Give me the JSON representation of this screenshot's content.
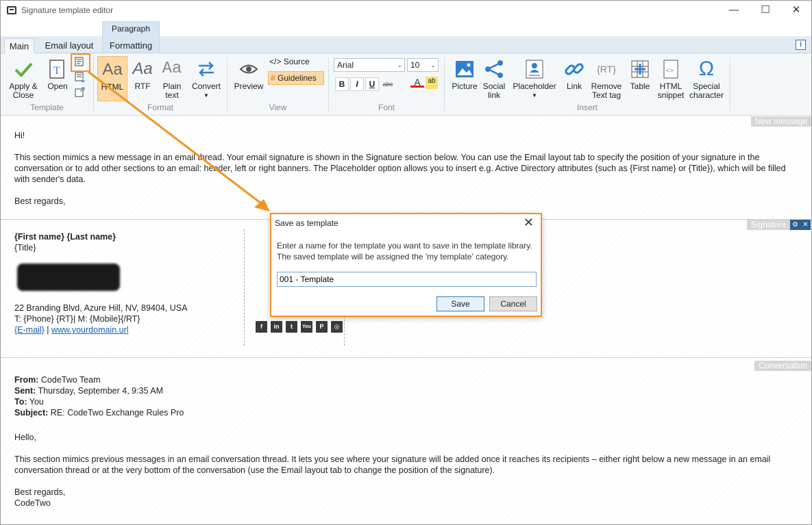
{
  "window": {
    "title": "Signature template editor",
    "minimize": "—",
    "maximize": "☐",
    "close": "✕"
  },
  "ribbon_tabs": {
    "context": "Paragraph",
    "main": "Main",
    "email_layout": "Email layout",
    "formatting": "Formatting",
    "info": "i"
  },
  "ribbon": {
    "apply_close": "Apply & Close",
    "open": "Open",
    "group_template": "Template",
    "html": "HTML",
    "rtf": "RTF",
    "plain_text": "Plain text",
    "convert": "Convert",
    "group_format": "Format",
    "preview": "Preview",
    "source": "Source",
    "guidelines": "Guidelines",
    "group_view": "View",
    "font_name": "Arial",
    "font_size": "10",
    "bold": "B",
    "italic": "I",
    "underline": "U",
    "strike": "abc",
    "group_font": "Font",
    "picture": "Picture",
    "social_link": "Social link",
    "placeholder": "Placeholder",
    "link": "Link",
    "remove_text_tag": "Remove Text tag",
    "table": "Table",
    "html_snippet": "HTML snippet",
    "special_character": "Special character",
    "group_insert": "Insert"
  },
  "new_message": {
    "label": "New message",
    "greeting": "Hi!",
    "body": "This section mimics a new message in an email thread. Your email signature is shown in the Signature section below. You can use the Email layout tab to specify the position of your signature in the conversation or to add other sections to an email: header, left or right banners. The Placeholder option allows you to insert e.g. Active Directory attributes (such as {First name} or {Title}), which will be filled with sender's data.",
    "closing": "Best regards,"
  },
  "signature": {
    "label": "Signature",
    "name": "{First name} {Last name}",
    "title": "{Title}",
    "address": "22 Branding Blvd, Azure Hill, NV, 89404, USA",
    "phones": "T: {Phone} {RT}| M: {Mobile}{/RT}",
    "email": "{E-mail}",
    "sep": " | ",
    "website": "www.yourdomain.url",
    "social": [
      "f",
      "in",
      "t",
      "You",
      "P",
      "◎"
    ]
  },
  "conversation": {
    "label": "Conversation",
    "from_label": "From:",
    "from": " CodeTwo Team",
    "sent_label": "Sent:",
    "sent": " Thursday, September 4, 9:35 AM",
    "to_label": "To:",
    "to": " You",
    "subject_label": "Subject:",
    "subject": " RE: CodeTwo Exchange Rules Pro",
    "hello": "Hello,",
    "body": "This section mimics previous messages in an email conversation thread. It lets you see where your signature will be added once it reaches its recipients – either right below a new message in an email conversation thread or at the very bottom of the conversation (use the Email layout tab to change the position of the signature).",
    "closing": "Best regards,",
    "sender": "CodeTwo"
  },
  "dialog": {
    "title": "Save as template",
    "text1": "Enter a name for the template you want to save in the template library.",
    "text2": "The saved template will be assigned the 'my template' category.",
    "input_value": "001 - Template",
    "save": "Save",
    "cancel": "Cancel"
  },
  "colors": {
    "accent": "#f39321",
    "link": "#1a5fb4",
    "ribbon_bg": "#f4f7fa"
  }
}
